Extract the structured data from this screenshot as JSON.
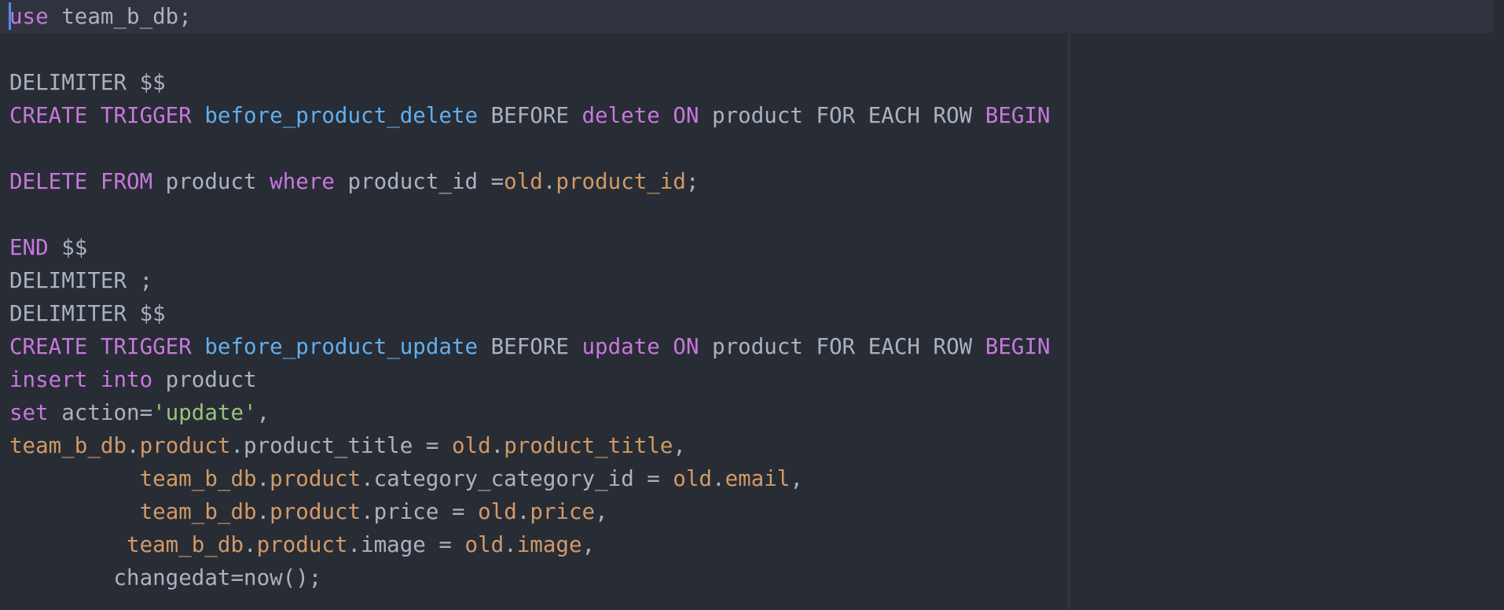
{
  "editor": {
    "colors": {
      "background": "#282c34",
      "current_line": "#2f333d",
      "plain": "#abb2bf",
      "keyword": "#c678dd",
      "function": "#61afef",
      "name": "#d19a66",
      "string": "#98c379",
      "cursor": "#528bff",
      "ruler": "#3e4451"
    },
    "lines": [
      {
        "tokens": [
          {
            "t": "use",
            "c": "kw"
          },
          {
            "t": " team_b_db;",
            "c": "pl"
          }
        ]
      },
      {
        "tokens": []
      },
      {
        "tokens": [
          {
            "t": "DELIMITER $$",
            "c": "pl"
          }
        ]
      },
      {
        "tokens": [
          {
            "t": "CREATE TRIGGER ",
            "c": "kw"
          },
          {
            "t": "before_product_delete",
            "c": "fn"
          },
          {
            "t": " BEFORE ",
            "c": "pl"
          },
          {
            "t": "delete ON",
            "c": "kw"
          },
          {
            "t": " product FOR EACH ROW ",
            "c": "pl"
          },
          {
            "t": "BEGIN",
            "c": "kw"
          }
        ]
      },
      {
        "tokens": []
      },
      {
        "tokens": [
          {
            "t": "DELETE FROM",
            "c": "kw"
          },
          {
            "t": " product ",
            "c": "pl"
          },
          {
            "t": "where",
            "c": "kw"
          },
          {
            "t": " product_id =",
            "c": "pl"
          },
          {
            "t": "old",
            "c": "nm"
          },
          {
            "t": ".",
            "c": "pl"
          },
          {
            "t": "product_id",
            "c": "nm"
          },
          {
            "t": ";",
            "c": "pl"
          }
        ]
      },
      {
        "tokens": []
      },
      {
        "tokens": [
          {
            "t": "END",
            "c": "kw"
          },
          {
            "t": " $$",
            "c": "pl"
          }
        ]
      },
      {
        "tokens": [
          {
            "t": "DELIMITER ;",
            "c": "pl"
          }
        ]
      },
      {
        "tokens": [
          {
            "t": "DELIMITER $$",
            "c": "pl"
          }
        ]
      },
      {
        "tokens": [
          {
            "t": "CREATE TRIGGER ",
            "c": "kw"
          },
          {
            "t": "before_product_update",
            "c": "fn"
          },
          {
            "t": " BEFORE ",
            "c": "pl"
          },
          {
            "t": "update ON",
            "c": "kw"
          },
          {
            "t": " product FOR EACH ROW ",
            "c": "pl"
          },
          {
            "t": "BEGIN",
            "c": "kw"
          }
        ]
      },
      {
        "tokens": [
          {
            "t": "insert into",
            "c": "kw"
          },
          {
            "t": " product",
            "c": "pl"
          }
        ]
      },
      {
        "tokens": [
          {
            "t": "set",
            "c": "kw"
          },
          {
            "t": " action=",
            "c": "pl"
          },
          {
            "t": "'update'",
            "c": "st"
          },
          {
            "t": ",",
            "c": "pl"
          }
        ]
      },
      {
        "tokens": [
          {
            "t": "team_b_db",
            "c": "nm"
          },
          {
            "t": ".",
            "c": "pl"
          },
          {
            "t": "product",
            "c": "nm"
          },
          {
            "t": ".product_title = ",
            "c": "pl"
          },
          {
            "t": "old",
            "c": "nm"
          },
          {
            "t": ".",
            "c": "pl"
          },
          {
            "t": "product_title",
            "c": "nm"
          },
          {
            "t": ",",
            "c": "pl"
          }
        ]
      },
      {
        "tokens": [
          {
            "t": "          ",
            "c": "pl"
          },
          {
            "t": "team_b_db",
            "c": "nm"
          },
          {
            "t": ".",
            "c": "pl"
          },
          {
            "t": "product",
            "c": "nm"
          },
          {
            "t": ".category_category_id = ",
            "c": "pl"
          },
          {
            "t": "old",
            "c": "nm"
          },
          {
            "t": ".",
            "c": "pl"
          },
          {
            "t": "email",
            "c": "nm"
          },
          {
            "t": ",",
            "c": "pl"
          }
        ]
      },
      {
        "tokens": [
          {
            "t": "          ",
            "c": "pl"
          },
          {
            "t": "team_b_db",
            "c": "nm"
          },
          {
            "t": ".",
            "c": "pl"
          },
          {
            "t": "product",
            "c": "nm"
          },
          {
            "t": ".price = ",
            "c": "pl"
          },
          {
            "t": "old",
            "c": "nm"
          },
          {
            "t": ".",
            "c": "pl"
          },
          {
            "t": "price",
            "c": "nm"
          },
          {
            "t": ",",
            "c": "pl"
          }
        ]
      },
      {
        "tokens": [
          {
            "t": "         ",
            "c": "pl"
          },
          {
            "t": "team_b_db",
            "c": "nm"
          },
          {
            "t": ".",
            "c": "pl"
          },
          {
            "t": "product",
            "c": "nm"
          },
          {
            "t": ".image = ",
            "c": "pl"
          },
          {
            "t": "old",
            "c": "nm"
          },
          {
            "t": ".",
            "c": "pl"
          },
          {
            "t": "image",
            "c": "nm"
          },
          {
            "t": ",",
            "c": "pl"
          }
        ]
      },
      {
        "tokens": [
          {
            "t": "        changedat=now();",
            "c": "pl"
          }
        ]
      }
    ]
  }
}
